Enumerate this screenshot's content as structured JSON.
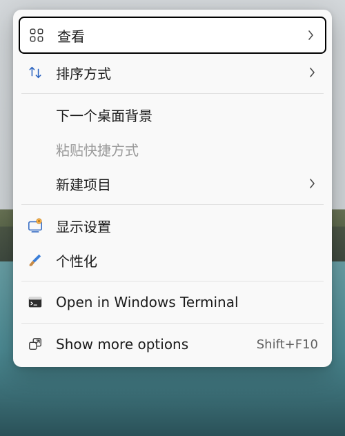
{
  "menu": {
    "items": [
      {
        "label": "查看",
        "sub": true,
        "highlighted": true
      },
      {
        "label": "排序方式",
        "sub": true
      },
      {
        "label": "下一个桌面背景"
      },
      {
        "label": "粘贴快捷方式",
        "disabled": true
      },
      {
        "label": "新建项目",
        "sub": true
      },
      {
        "label": "显示设置"
      },
      {
        "label": "个性化"
      },
      {
        "label": "Open in Windows Terminal"
      },
      {
        "label": "Show more options",
        "shortcut": "Shift+F10"
      }
    ]
  }
}
